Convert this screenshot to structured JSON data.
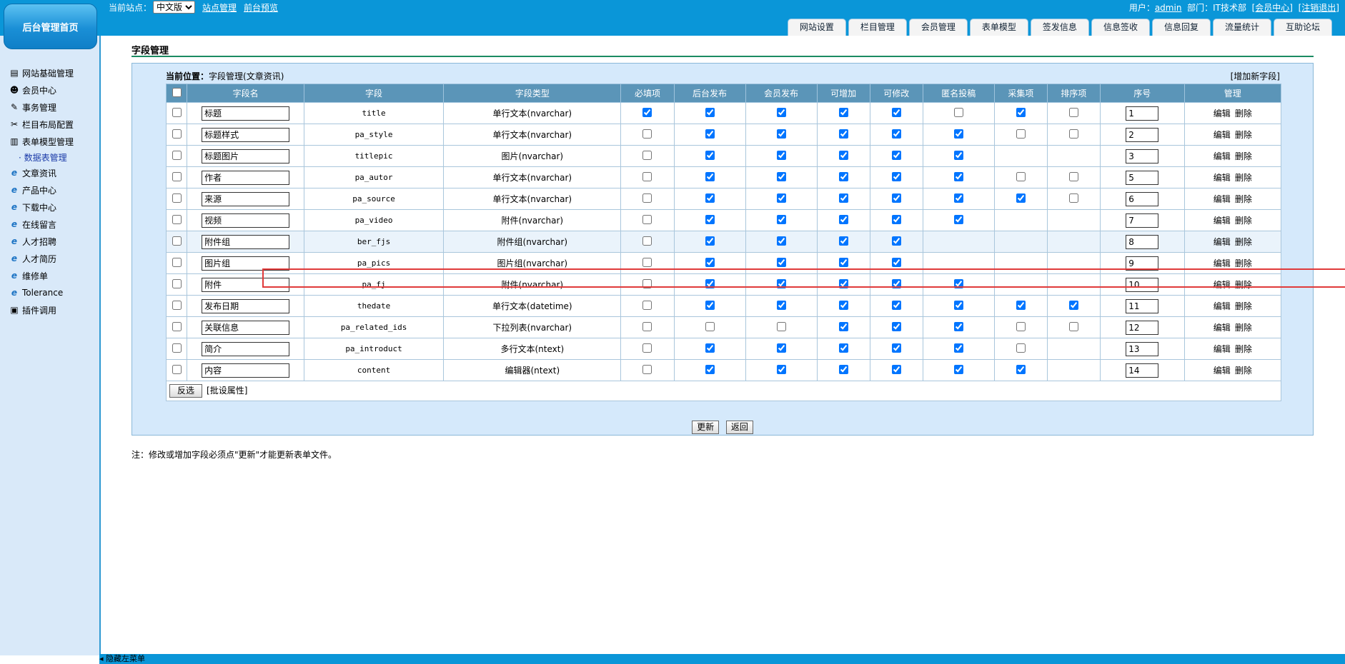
{
  "header": {
    "logo": "后台管理首页",
    "site_label": "当前站点：",
    "site_select": "中文版",
    "site_manage": "站点管理",
    "front_preview": "前台预览",
    "user_label": "用户：",
    "user_name": "admin",
    "dept_label": "部门：",
    "dept_name": "IT技术部",
    "member_center": "[会员中心]",
    "logout": "[注销退出]"
  },
  "nav_tabs": [
    "网站设置",
    "栏目管理",
    "会员管理",
    "表单模型",
    "签发信息",
    "信息签收",
    "信息回复",
    "流量统计",
    "互助论坛"
  ],
  "sidebar": {
    "items": [
      {
        "label": "网站基础管理",
        "icon": "website-icon"
      },
      {
        "label": "会员中心",
        "icon": "members-icon"
      },
      {
        "label": "事务管理",
        "icon": "affairs-icon"
      },
      {
        "label": "栏目布局配置",
        "icon": "tools-icon"
      },
      {
        "label": "表单模型管理",
        "icon": "form-model-icon"
      },
      {
        "label": "· 数据表管理",
        "icon": "",
        "sub": true
      },
      {
        "label": "文章资讯",
        "icon": "ie-icon"
      },
      {
        "label": "产品中心",
        "icon": "ie-icon"
      },
      {
        "label": "下载中心",
        "icon": "ie-icon"
      },
      {
        "label": "在线留言",
        "icon": "ie-icon"
      },
      {
        "label": "人才招聘",
        "icon": "ie-icon"
      },
      {
        "label": "人才简历",
        "icon": "ie-icon"
      },
      {
        "label": "维修单",
        "icon": "ie-icon"
      },
      {
        "label": "Tolerance",
        "icon": "ie-icon"
      },
      {
        "label": "插件调用",
        "icon": "plugin-icon"
      }
    ]
  },
  "bottom": {
    "hide_menu": "隐藏左菜单"
  },
  "page": {
    "title": "字段管理",
    "crumb_label": "当前位置：",
    "crumb_value": "字段管理(文章资讯)",
    "add_field": "[增加新字段]",
    "note": "注：修改或增加字段必须点\"更新\"才能更新表单文件。"
  },
  "table": {
    "headers": [
      "字段名",
      "字段",
      "字段类型",
      "必填项",
      "后台发布",
      "会员发布",
      "可增加",
      "可修改",
      "匿名投稿",
      "采集项",
      "排序项",
      "序号",
      "管理"
    ],
    "edit_label": "编辑",
    "delete_label": "删除",
    "rows": [
      {
        "name": "标题",
        "field": "title",
        "type": "单行文本(nvarchar)",
        "req": true,
        "bg": true,
        "mem": true,
        "add": true,
        "mod": true,
        "anon": false,
        "col": true,
        "sort": false,
        "order": "1"
      },
      {
        "name": "标题样式",
        "field": "pa_style",
        "type": "单行文本(nvarchar)",
        "req": false,
        "bg": true,
        "mem": true,
        "add": true,
        "mod": true,
        "anon": true,
        "col": false,
        "sort": false,
        "order": "2"
      },
      {
        "name": "标题图片",
        "field": "titlepic",
        "type": "图片(nvarchar)",
        "req": false,
        "bg": true,
        "mem": true,
        "add": true,
        "mod": true,
        "anon": true,
        "col": null,
        "sort": null,
        "order": "3"
      },
      {
        "name": "作者",
        "field": "pa_autor",
        "type": "单行文本(nvarchar)",
        "req": false,
        "bg": true,
        "mem": true,
        "add": true,
        "mod": true,
        "anon": true,
        "col": false,
        "sort": false,
        "order": "5"
      },
      {
        "name": "来源",
        "field": "pa_source",
        "type": "单行文本(nvarchar)",
        "req": false,
        "bg": true,
        "mem": true,
        "add": true,
        "mod": true,
        "anon": true,
        "col": true,
        "sort": false,
        "order": "6"
      },
      {
        "name": "视频",
        "field": "pa_video",
        "type": "附件(nvarchar)",
        "req": false,
        "bg": true,
        "mem": true,
        "add": true,
        "mod": true,
        "anon": true,
        "col": null,
        "sort": null,
        "order": "7"
      },
      {
        "name": "附件组",
        "field": "ber_fjs",
        "type": "附件组(nvarchar)",
        "req": false,
        "bg": true,
        "mem": true,
        "add": true,
        "mod": true,
        "anon": null,
        "col": null,
        "sort": null,
        "order": "8",
        "highlight": true
      },
      {
        "name": "图片组",
        "field": "pa_pics",
        "type": "图片组(nvarchar)",
        "req": false,
        "bg": true,
        "mem": true,
        "add": true,
        "mod": true,
        "anon": null,
        "col": null,
        "sort": null,
        "order": "9"
      },
      {
        "name": "附件",
        "field": "pa_fj",
        "type": "附件(nvarchar)",
        "req": false,
        "bg": true,
        "mem": true,
        "add": true,
        "mod": true,
        "anon": true,
        "col": null,
        "sort": null,
        "order": "10"
      },
      {
        "name": "发布日期",
        "field": "thedate",
        "type": "单行文本(datetime)",
        "req": false,
        "bg": true,
        "mem": true,
        "add": true,
        "mod": true,
        "anon": true,
        "col": true,
        "sort": true,
        "order": "11"
      },
      {
        "name": "关联信息",
        "field": "pa_related_ids",
        "type": "下拉列表(nvarchar)",
        "req": false,
        "bg": false,
        "mem": false,
        "add": true,
        "mod": true,
        "anon": true,
        "col": false,
        "sort": false,
        "order": "12"
      },
      {
        "name": "简介",
        "field": "pa_introduct",
        "type": "多行文本(ntext)",
        "req": false,
        "bg": true,
        "mem": true,
        "add": true,
        "mod": true,
        "anon": true,
        "col": false,
        "sort": null,
        "order": "13"
      },
      {
        "name": "内容",
        "field": "content",
        "type": "编辑器(ntext)",
        "req": false,
        "bg": true,
        "mem": true,
        "add": true,
        "mod": true,
        "anon": true,
        "col": true,
        "sort": null,
        "order": "14"
      }
    ],
    "invert_label": "反选",
    "batch_label": "[批设属性]"
  },
  "buttons": {
    "update": "更新",
    "back": "返回"
  }
}
